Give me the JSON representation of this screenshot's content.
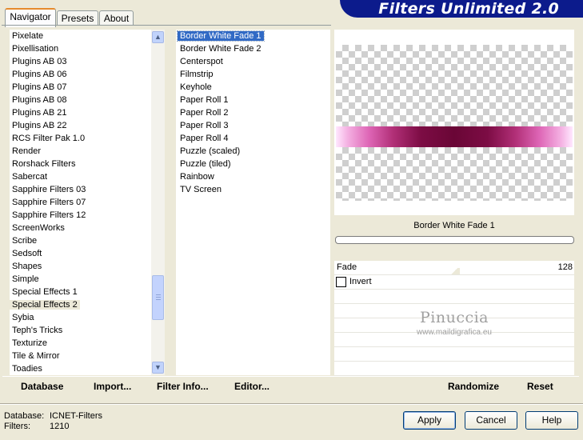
{
  "app": {
    "title": "Filters Unlimited 2.0"
  },
  "tabs": [
    {
      "label": "Navigator",
      "active": true
    },
    {
      "label": "Presets",
      "active": false
    },
    {
      "label": "About",
      "active": false
    }
  ],
  "categories": {
    "items": [
      "Pixelate",
      "Pixellisation",
      "Plugins AB 03",
      "Plugins AB 06",
      "Plugins AB 07",
      "Plugins AB 08",
      "Plugins AB 21",
      "Plugins AB 22",
      "RCS Filter Pak 1.0",
      "Render",
      "Rorshack Filters",
      "Sabercat",
      "Sapphire Filters 03",
      "Sapphire Filters 07",
      "Sapphire Filters 12",
      "ScreenWorks",
      "Scribe",
      "Sedsoft",
      "Shapes",
      "Simple",
      "Special Effects 1",
      "Special Effects 2",
      "Sybia",
      "Teph's Tricks",
      "Texturize",
      "Tile & Mirror",
      "Toadies"
    ],
    "selected": "Special Effects 2"
  },
  "filters": {
    "items": [
      "Border White Fade 1",
      "Border White Fade 2",
      "Centerspot",
      "Filmstrip",
      "Keyhole",
      "Paper Roll 1",
      "Paper Roll 2",
      "Paper Roll 3",
      "Paper Roll 4",
      "Puzzle (scaled)",
      "Puzzle (tiled)",
      "Rainbow",
      "TV Screen"
    ],
    "selected": "Border White Fade 1"
  },
  "preview": {
    "filter_name": "Border White Fade 1"
  },
  "params": {
    "fade_label": "Fade",
    "fade_value": "128",
    "fade_fraction": 0.5,
    "invert_label": "Invert",
    "invert_checked": false
  },
  "watermark": {
    "name": "Pinuccia",
    "url": "www.maildigrafica.eu"
  },
  "toolbar": {
    "database_label": "Database",
    "import_label": "Import...",
    "filter_info_label": "Filter Info...",
    "editor_label": "Editor...",
    "randomize_label": "Randomize",
    "reset_label": "Reset"
  },
  "status": {
    "database_label": "Database:",
    "database_value": "ICNET-Filters",
    "filters_label": "Filters:",
    "filters_value": "1210"
  },
  "buttons": {
    "apply": "Apply",
    "cancel": "Cancel",
    "help": "Help"
  },
  "colors": {
    "banner": "#0c1b8c",
    "selection": "#316ac5",
    "face": "#ece9d8",
    "fade_dark": "#6a0636",
    "fade_light": "#ffe8ff"
  }
}
